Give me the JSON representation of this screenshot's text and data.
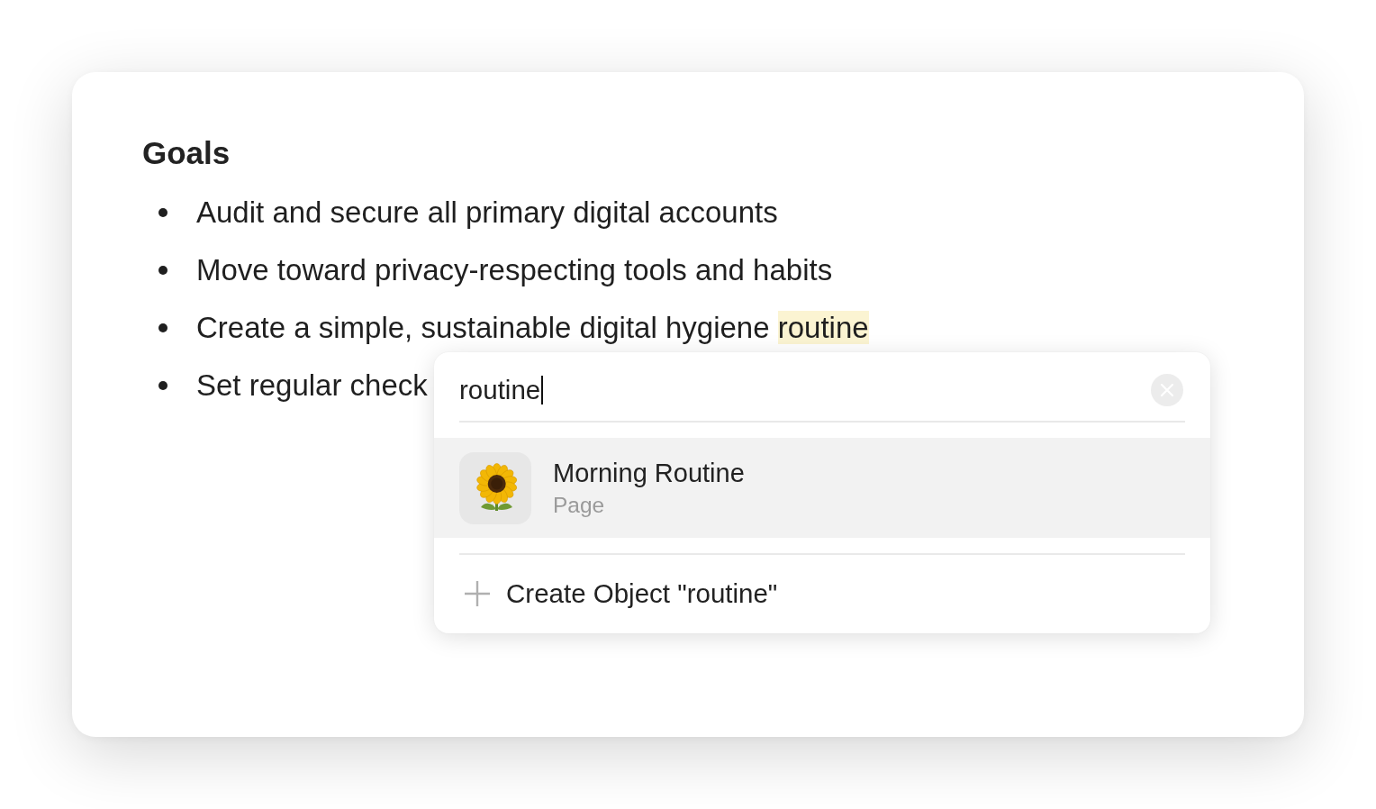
{
  "document": {
    "heading": "Goals",
    "bullets": [
      {
        "segments": [
          {
            "text": "Audit and secure all primary digital accounts",
            "highlighted": false
          }
        ]
      },
      {
        "segments": [
          {
            "text": "Move toward privacy-respecting tools and habits",
            "highlighted": false
          }
        ]
      },
      {
        "segments": [
          {
            "text": "Create a simple, sustainable digital hygiene ",
            "highlighted": false
          },
          {
            "text": "routine",
            "highlighted": true
          }
        ]
      },
      {
        "segments": [
          {
            "text": "Set regular check",
            "highlighted": false
          }
        ]
      }
    ]
  },
  "search_popup": {
    "query": "routine",
    "focused": true,
    "results": [
      {
        "title": "Morning Routine",
        "subtitle": "Page",
        "selected": true
      }
    ],
    "create_action": {
      "label": "Create Object \"routine\""
    }
  }
}
